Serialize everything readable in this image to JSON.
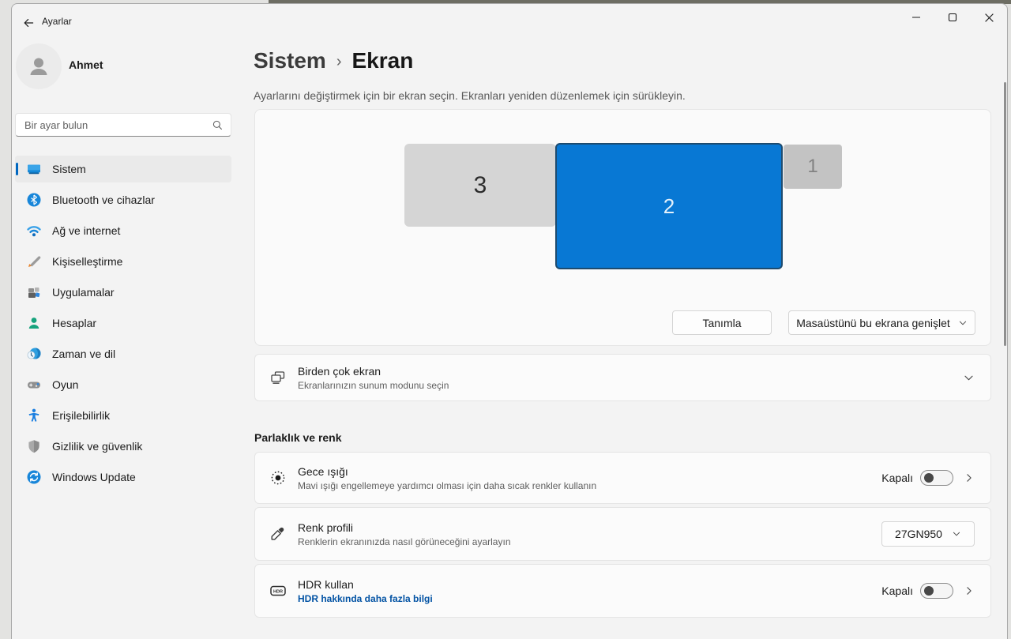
{
  "window": {
    "title": "Ayarlar"
  },
  "sidebar": {
    "user": {
      "name": "Ahmet"
    },
    "search": {
      "placeholder": "Bir ayar bulun"
    },
    "items": [
      {
        "label": "Sistem",
        "icon": "system-icon",
        "selected": true
      },
      {
        "label": "Bluetooth ve cihazlar",
        "icon": "bluetooth-icon"
      },
      {
        "label": "Ağ ve internet",
        "icon": "network-icon"
      },
      {
        "label": "Kişiselleştirme",
        "icon": "personalization-icon"
      },
      {
        "label": "Uygulamalar",
        "icon": "apps-icon"
      },
      {
        "label": "Hesaplar",
        "icon": "accounts-icon"
      },
      {
        "label": "Zaman ve dil",
        "icon": "time-language-icon"
      },
      {
        "label": "Oyun",
        "icon": "gaming-icon"
      },
      {
        "label": "Erişilebilirlik",
        "icon": "accessibility-icon"
      },
      {
        "label": "Gizlilik ve güvenlik",
        "icon": "privacy-icon"
      },
      {
        "label": "Windows Update",
        "icon": "windows-update-icon"
      }
    ]
  },
  "main": {
    "breadcrumb": {
      "parent": "Sistem",
      "separator": "›",
      "current": "Ekran"
    },
    "description": "Ayarlarını değiştirmek için bir ekran seçin. Ekranları yeniden düzenlemek için sürükleyin.",
    "display_panel": {
      "monitors": [
        {
          "label": "3"
        },
        {
          "label": "2",
          "selected": true
        },
        {
          "label": "1"
        }
      ],
      "identify_button": "Tanımla",
      "mode_dropdown": "Masaüstünü bu ekrana genişlet"
    },
    "multiple_displays": {
      "title": "Birden çok ekran",
      "subtitle": "Ekranlarınızın sunum modunu seçin"
    },
    "section_title": "Parlaklık ve renk",
    "rows": [
      {
        "title": "Gece ışığı",
        "subtitle": "Mavi ışığı engellemeye yardımcı olması için daha sıcak renkler kullanın",
        "status": "Kapalı"
      },
      {
        "title": "Renk profili",
        "subtitle": "Renklerin ekranınızda nasıl görüneceğini ayarlayın",
        "value": "27GN950"
      },
      {
        "title": "HDR kullan",
        "link": "HDR hakkında daha fazla bilgi",
        "status": "Kapalı"
      }
    ]
  },
  "icons": {
    "hdr_badge": "HDR"
  },
  "colors": {
    "accent": "#0878d4",
    "accent_bar": "#0067c0",
    "link": "#0353a4"
  }
}
